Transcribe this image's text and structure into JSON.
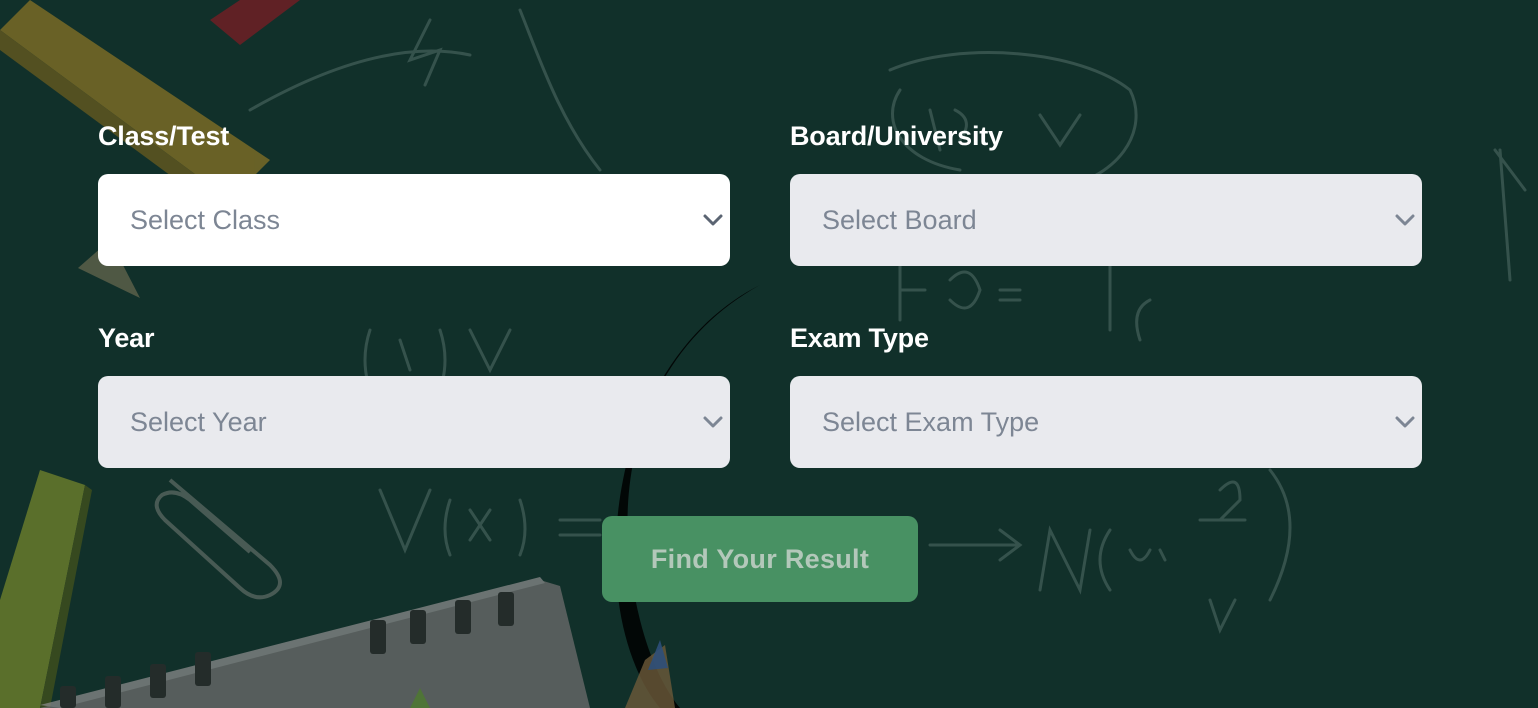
{
  "form": {
    "class_field": {
      "label": "Class/Test",
      "placeholder": "Select Class"
    },
    "board_field": {
      "label": "Board/University",
      "placeholder": "Select Board"
    },
    "year_field": {
      "label": "Year",
      "placeholder": "Select Year"
    },
    "exam_type_field": {
      "label": "Exam Type",
      "placeholder": "Select Exam Type"
    },
    "submit_label": "Find Your Result"
  },
  "colors": {
    "background": "#11302a",
    "select_bg": "#e9eaee",
    "select_active_bg": "#ffffff",
    "placeholder_text": "#7d8694",
    "button_bg": "#489163",
    "button_text": "#b3c8ba"
  },
  "icons": [
    "chevron-down-icon"
  ]
}
